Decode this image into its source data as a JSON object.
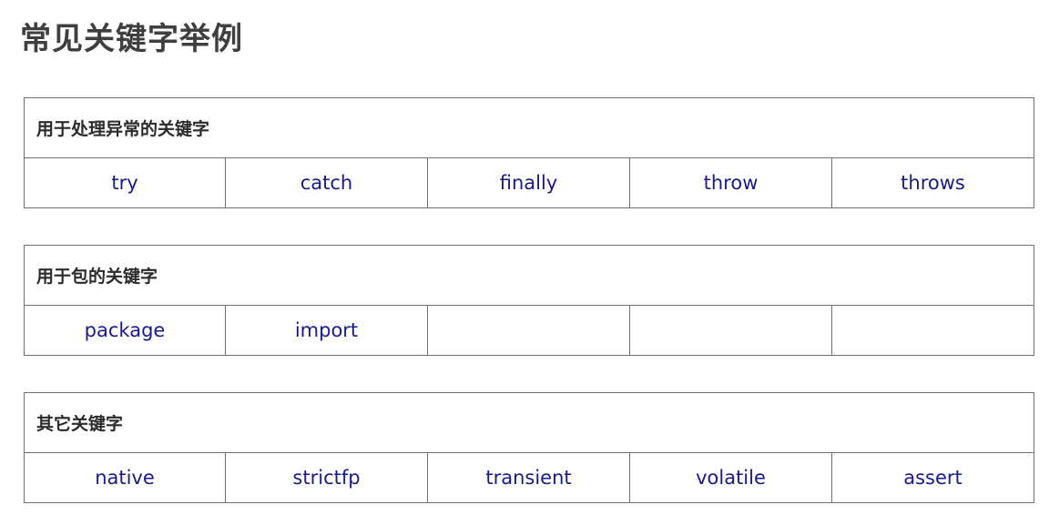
{
  "page": {
    "title": "常见关键字举例"
  },
  "sections": [
    {
      "heading": "用于处理异常的关键字",
      "keywords": [
        "try",
        "catch",
        "finally",
        "throw",
        "throws"
      ]
    },
    {
      "heading": "用于包的关键字",
      "keywords": [
        "package",
        "import",
        "",
        "",
        ""
      ]
    },
    {
      "heading": "其它关键字",
      "keywords": [
        "native",
        "strictfp",
        "transient",
        "volatile",
        "assert"
      ]
    }
  ],
  "colors": {
    "keyword_text": "#1a1a8c",
    "heading_text": "#2b2b2b",
    "title_text": "#3f3f3f",
    "border": "#707070"
  }
}
